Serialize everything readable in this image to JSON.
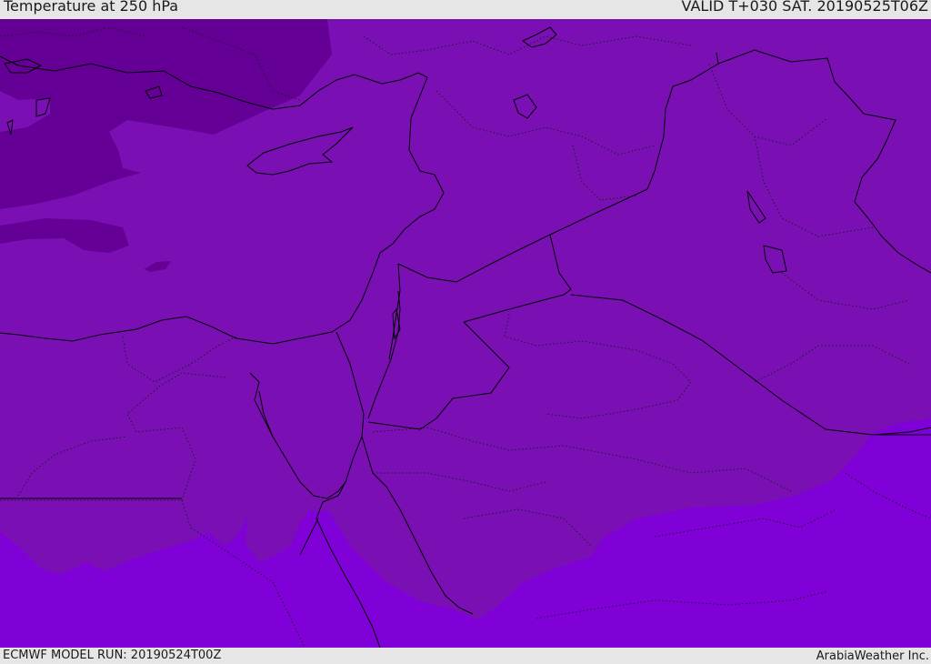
{
  "header": {
    "title": "Temperature at 250 hPa",
    "valid_time": "VALID T+030 SAT. 20190525T06Z"
  },
  "footer": {
    "model_run": "ECMWF MODEL RUN: 20190524T00Z",
    "credit": "ArabiaWeather Inc."
  },
  "map": {
    "colors": {
      "cold_band": "#640096",
      "main_band": "#7a10b4",
      "warm_band": "#8000d8",
      "coastline": "#000000",
      "boundary": "#1a1a2a"
    }
  }
}
